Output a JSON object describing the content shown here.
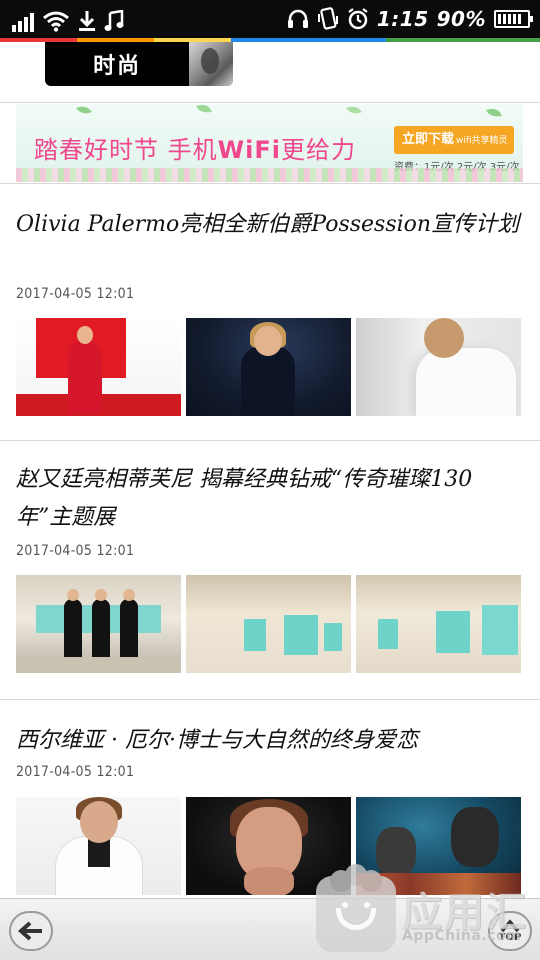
{
  "status_bar": {
    "time": "1:15",
    "battery_percent": "90%",
    "battery_level": 0.9,
    "icons": [
      "signal-icon",
      "wifi-icon",
      "download-icon",
      "music-icon",
      "headphones-icon",
      "vibrate-icon",
      "alarm-icon",
      "battery-icon"
    ]
  },
  "color_strip": [
    "#e53935",
    "#ff9800",
    "#ffd54f",
    "#1e88e5",
    "#1e88e5",
    "#43a047",
    "#43a047"
  ],
  "header": {
    "section_label": "时尚"
  },
  "banner_ad": {
    "headline_part1": "踏春好时节 手机",
    "headline_wifi": "WiFi",
    "headline_part2": "更给力",
    "button_label": "立即下载",
    "button_sub": "wifi共享精灵",
    "price_text": "资费：1元/次 2元/次 3元/次",
    "accent_color": "#f0478d",
    "button_color": "#f5a623"
  },
  "articles": [
    {
      "title": "Olivia Palermo亮相全新伯爵Possession宣传计划",
      "date": "2017-04-05 12:01"
    },
    {
      "title": "赵又廷亮相蒂芙尼 揭幕经典钻戒“传奇璀璨130年”主题展",
      "date": "2017-04-05 12:01"
    },
    {
      "title": "西尔维亚 · 厄尔·博士与大自然的终身爱恋",
      "date": "2017-04-05 12:01"
    }
  ],
  "bottom_bar": {
    "back_icon": "back-arrow-icon",
    "top_label": "TOP",
    "top_icon": "up-arrow-icon"
  },
  "watermark": {
    "brand": "应用汇",
    "sub": "AppChina.com"
  }
}
